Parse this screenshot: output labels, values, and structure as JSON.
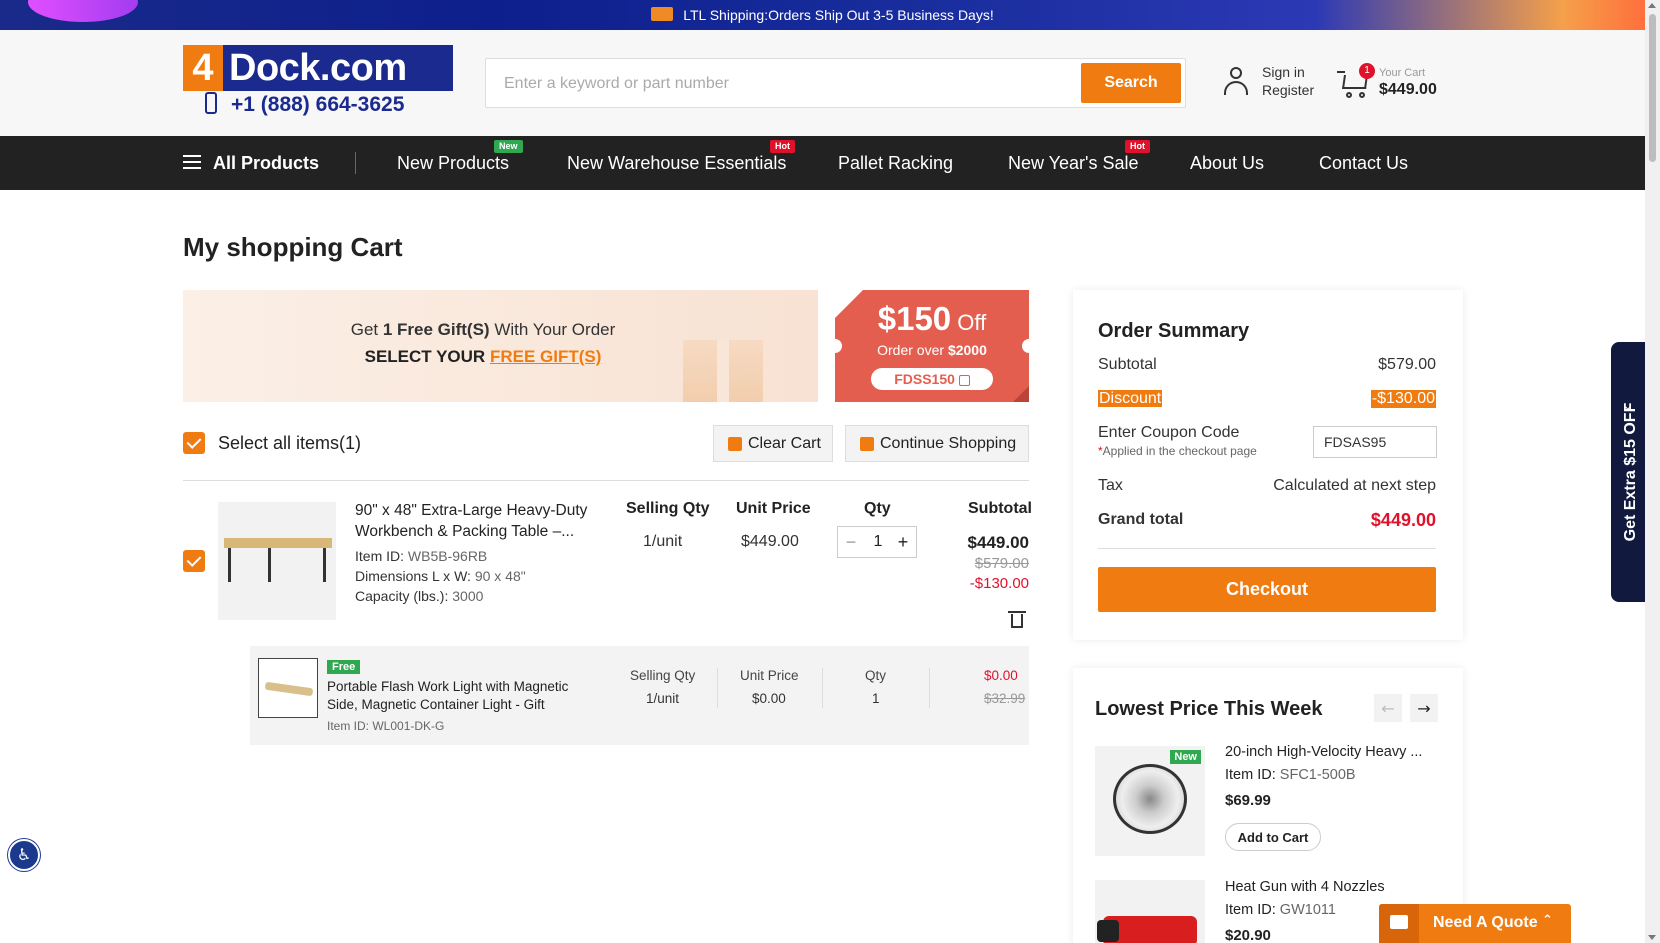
{
  "banner": {
    "text": "LTL Shipping:Orders Ship Out 3-5 Business Days!"
  },
  "header": {
    "logo_four": "4",
    "logo_dock": "Dock.com",
    "phone": "+1 (888) 664-3625",
    "search": {
      "placeholder": "Enter a keyword or part number",
      "value": "",
      "button": "Search"
    },
    "account": {
      "sign_in": "Sign in",
      "register": "Register"
    },
    "cart": {
      "label": "Your Cart",
      "amount": "$449.00",
      "count": "1"
    }
  },
  "nav": {
    "all_products": "All Products",
    "items": [
      {
        "label": "New Products",
        "tag": "New"
      },
      {
        "label": "New Warehouse Essentials",
        "tag": "Hot"
      },
      {
        "label": "Pallet Racking",
        "tag": ""
      },
      {
        "label": "New Year's Sale",
        "tag": "Hot"
      },
      {
        "label": "About Us",
        "tag": ""
      },
      {
        "label": "Contact Us",
        "tag": ""
      }
    ]
  },
  "page_title": "My shopping Cart",
  "gift_banner": {
    "get": "Get ",
    "count": "1 Free Gift(S)",
    "with": " With Your Order",
    "select": "SELECT YOUR ",
    "link": "FREE GIFT(S)"
  },
  "coupon": {
    "amount": "$150",
    "off": " Off",
    "order_over": "Order over ",
    "threshold": "$2000",
    "code": "FDSS150"
  },
  "cart_controls": {
    "select_all": "Select all items(1)",
    "clear_cart": "Clear Cart",
    "continue_shopping": "Continue Shopping"
  },
  "columns": {
    "selling_qty": "Selling Qty",
    "unit_price": "Unit Price",
    "qty": "Qty",
    "subtotal": "Subtotal"
  },
  "item": {
    "name_line1": "90\" x 48\" Extra-Large Heavy-Duty",
    "name_line2": "Workbench & Packing Table –...",
    "id_label": "Item ID: ",
    "id": "WB5B-96RB",
    "dim_label": "Dimensions L x W: ",
    "dim": "90 x 48\"",
    "cap_label": "Capacity (lbs.): ",
    "cap": "3000",
    "selling_qty": "1/unit",
    "unit_price": "$449.00",
    "qty": "1",
    "subtotal": "$449.00",
    "original": "$579.00",
    "discount": "-$130.00"
  },
  "gift_item": {
    "badge": "Free",
    "name_line1": "Portable Flash Work Light with Magnetic",
    "name_line2": "Side, Magnetic Container Light - Gift",
    "id": "Item ID: WL001-DK-G",
    "selling_qty": "1/unit",
    "unit_price": "$0.00",
    "qty": "1",
    "price": "$0.00",
    "original": "$32.99"
  },
  "summary": {
    "title": "Order Summary",
    "subtotal_label": "Subtotal",
    "subtotal": "$579.00",
    "discount_label": "Discount",
    "discount": "-$130.00",
    "coupon_label": "Enter Coupon Code",
    "coupon_value": "FDSAS95",
    "applied_star": "*",
    "applied_text": "Applied in the checkout page",
    "tax_label": "Tax",
    "tax": "Calculated at next step",
    "grand_label": "Grand total",
    "grand": "$449.00",
    "checkout": "Checkout"
  },
  "lowest": {
    "title": "Lowest Price This Week",
    "prev": "←",
    "next": "→",
    "products": [
      {
        "name": "20-inch High-Velocity Heavy ...",
        "id_label": "Item ID: ",
        "id": "SFC1-500B",
        "price": "$69.99",
        "badge": "New",
        "button": "Add to Cart"
      },
      {
        "name": "Heat Gun with 4 Nozzles",
        "id_label": "Item ID: ",
        "id": "GW1011",
        "price": "$20.90"
      }
    ]
  },
  "side_tab": {
    "text": "Get Extra $15 OFF",
    "chevron": "‹"
  },
  "quote": {
    "text": "Need A Quote",
    "chevron": "⌃"
  },
  "accessibility": {
    "icon": "♿"
  },
  "colors": {
    "accent": "#f07c11",
    "brand": "#1b2a8e",
    "price_red": "#e0122b",
    "coupon": "#e45e50",
    "new": "#2fa84f"
  }
}
